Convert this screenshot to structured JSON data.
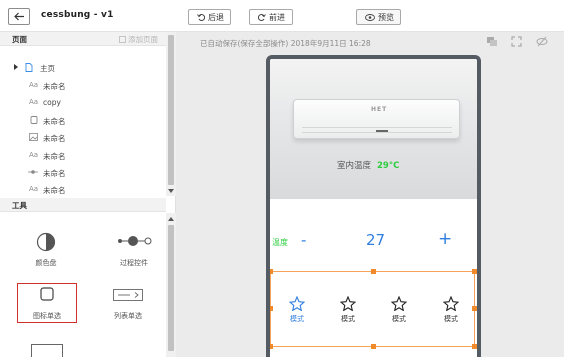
{
  "header": {
    "title": "cessbung - v1",
    "undo_label": "后退",
    "redo_label": "前进",
    "preview_label": "预览"
  },
  "pages_panel": {
    "title": "页面",
    "add_label": "添加页面",
    "items": [
      {
        "label": "主页",
        "icon": "page-icon",
        "expandable": true
      },
      {
        "label": "未命名",
        "icon": "text-icon"
      },
      {
        "label": "copy",
        "icon": "text-icon"
      },
      {
        "label": "未命名",
        "icon": "button-icon"
      },
      {
        "label": "未命名",
        "icon": "image-icon"
      },
      {
        "label": "未命名",
        "icon": "text-icon"
      },
      {
        "label": "未命名",
        "icon": "slider-icon"
      },
      {
        "label": "未命名",
        "icon": "text-icon"
      }
    ]
  },
  "tools_panel": {
    "title": "工具",
    "items": [
      {
        "label": "颜色盘",
        "icon": "color-wheel-icon"
      },
      {
        "label": "过程控件",
        "icon": "process-control-icon"
      },
      {
        "label": "图标单选",
        "icon": "icon-radio-icon",
        "selected": true
      },
      {
        "label": "列表单选",
        "icon": "list-radio-icon"
      }
    ]
  },
  "canvas": {
    "autosave_text": "已自动保存(保存全部操作) 2018年9月11日 16:28"
  },
  "phone": {
    "ac_brand": "HET",
    "temp_label": "室内温度",
    "temp_value": "29°C",
    "control": {
      "label": "温度",
      "minus": "-",
      "value": "27",
      "plus": "+"
    },
    "modes": [
      {
        "label": "模式",
        "active": true
      },
      {
        "label": "模式",
        "active": false
      },
      {
        "label": "模式",
        "active": false
      },
      {
        "label": "模式",
        "active": false
      }
    ]
  },
  "colors": {
    "accent_blue": "#2f7ddf",
    "accent_green": "#2ecc40",
    "selection_orange": "#f08a2a",
    "selected_tool_red": "#d0312d"
  }
}
